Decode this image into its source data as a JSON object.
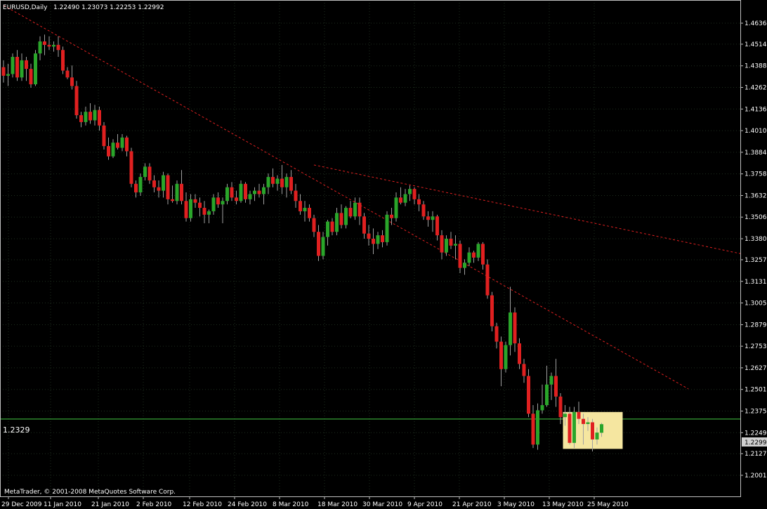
{
  "window": {
    "symbol_label": "EURUSD,Daily",
    "ohlc_label": "1.22490 1.23073 1.22253 1.22992",
    "copyright": "MetaTrader, © 2001-2008 MetaQuotes Software Corp."
  },
  "colors": {
    "background": "#000000",
    "grid": "#1e2e1e",
    "frame": "#c0c0c0",
    "bull": "#2aa52a",
    "bear": "#e02020",
    "wick": "#a0a0a0",
    "trendline": "#e02020",
    "hline": "#44cc44",
    "highlight": "#f5e6a0",
    "current_price_bg": "#d0d0d0"
  },
  "chart_data": {
    "type": "candlestick",
    "symbol": "EURUSD",
    "timeframe": "Daily",
    "ylim": [
      1.2001,
      1.4689
    ],
    "yticks": [
      "1.46365",
      "1.45140",
      "1.43880",
      "1.42620",
      "1.41360",
      "1.40100",
      "1.38840",
      "1.37580",
      "1.36320",
      "1.35060",
      "1.33800",
      "1.32575",
      "1.31315",
      "1.30055",
      "1.28790",
      "1.27535",
      "1.26275",
      "1.25015",
      "1.23755",
      "1.22495",
      "1.21270",
      "1.20010"
    ],
    "xticks": [
      "29 Dec 2009",
      "11 Jan 2010",
      "21 Jan 2010",
      "2 Feb 2010",
      "12 Feb 2010",
      "24 Feb 2010",
      "8 Mar 2010",
      "18 Mar 2010",
      "30 Mar 2010",
      "9 Apr 2010",
      "21 Apr 2010",
      "3 May 2010",
      "13 May 2010",
      "25 May 2010"
    ],
    "grid": true,
    "hline": {
      "value": 1.2329,
      "label": "1.2329"
    },
    "current_price": "1.22992",
    "candles": [
      {
        "o": 1.438,
        "h": 1.442,
        "l": 1.429,
        "c": 1.433
      },
      {
        "o": 1.433,
        "h": 1.44,
        "l": 1.427,
        "c": 1.434
      },
      {
        "o": 1.434,
        "h": 1.446,
        "l": 1.432,
        "c": 1.444
      },
      {
        "o": 1.444,
        "h": 1.448,
        "l": 1.43,
        "c": 1.432
      },
      {
        "o": 1.432,
        "h": 1.446,
        "l": 1.43,
        "c": 1.442
      },
      {
        "o": 1.442,
        "h": 1.444,
        "l": 1.43,
        "c": 1.437
      },
      {
        "o": 1.437,
        "h": 1.44,
        "l": 1.426,
        "c": 1.428
      },
      {
        "o": 1.428,
        "h": 1.448,
        "l": 1.427,
        "c": 1.446
      },
      {
        "o": 1.446,
        "h": 1.456,
        "l": 1.442,
        "c": 1.453
      },
      {
        "o": 1.453,
        "h": 1.457,
        "l": 1.445,
        "c": 1.451
      },
      {
        "o": 1.451,
        "h": 1.456,
        "l": 1.448,
        "c": 1.45
      },
      {
        "o": 1.45,
        "h": 1.453,
        "l": 1.447,
        "c": 1.451
      },
      {
        "o": 1.451,
        "h": 1.456,
        "l": 1.444,
        "c": 1.448
      },
      {
        "o": 1.448,
        "h": 1.45,
        "l": 1.434,
        "c": 1.436
      },
      {
        "o": 1.436,
        "h": 1.438,
        "l": 1.431,
        "c": 1.432
      },
      {
        "o": 1.432,
        "h": 1.439,
        "l": 1.425,
        "c": 1.427
      },
      {
        "o": 1.427,
        "h": 1.43,
        "l": 1.408,
        "c": 1.41
      },
      {
        "o": 1.41,
        "h": 1.412,
        "l": 1.403,
        "c": 1.406
      },
      {
        "o": 1.406,
        "h": 1.415,
        "l": 1.404,
        "c": 1.412
      },
      {
        "o": 1.412,
        "h": 1.417,
        "l": 1.405,
        "c": 1.407
      },
      {
        "o": 1.407,
        "h": 1.416,
        "l": 1.404,
        "c": 1.413
      },
      {
        "o": 1.413,
        "h": 1.415,
        "l": 1.401,
        "c": 1.404
      },
      {
        "o": 1.404,
        "h": 1.406,
        "l": 1.39,
        "c": 1.392
      },
      {
        "o": 1.392,
        "h": 1.397,
        "l": 1.384,
        "c": 1.386
      },
      {
        "o": 1.386,
        "h": 1.396,
        "l": 1.385,
        "c": 1.394
      },
      {
        "o": 1.394,
        "h": 1.399,
        "l": 1.39,
        "c": 1.391
      },
      {
        "o": 1.391,
        "h": 1.399,
        "l": 1.389,
        "c": 1.397
      },
      {
        "o": 1.397,
        "h": 1.398,
        "l": 1.386,
        "c": 1.389
      },
      {
        "o": 1.389,
        "h": 1.391,
        "l": 1.368,
        "c": 1.37
      },
      {
        "o": 1.37,
        "h": 1.372,
        "l": 1.362,
        "c": 1.365
      },
      {
        "o": 1.365,
        "h": 1.376,
        "l": 1.363,
        "c": 1.374
      },
      {
        "o": 1.374,
        "h": 1.382,
        "l": 1.372,
        "c": 1.38
      },
      {
        "o": 1.38,
        "h": 1.382,
        "l": 1.37,
        "c": 1.372
      },
      {
        "o": 1.372,
        "h": 1.375,
        "l": 1.365,
        "c": 1.368
      },
      {
        "o": 1.368,
        "h": 1.372,
        "l": 1.362,
        "c": 1.366
      },
      {
        "o": 1.366,
        "h": 1.377,
        "l": 1.362,
        "c": 1.375
      },
      {
        "o": 1.375,
        "h": 1.376,
        "l": 1.358,
        "c": 1.361
      },
      {
        "o": 1.361,
        "h": 1.369,
        "l": 1.359,
        "c": 1.36
      },
      {
        "o": 1.36,
        "h": 1.372,
        "l": 1.358,
        "c": 1.37
      },
      {
        "o": 1.37,
        "h": 1.378,
        "l": 1.358,
        "c": 1.36
      },
      {
        "o": 1.36,
        "h": 1.365,
        "l": 1.348,
        "c": 1.35
      },
      {
        "o": 1.35,
        "h": 1.364,
        "l": 1.348,
        "c": 1.361
      },
      {
        "o": 1.361,
        "h": 1.364,
        "l": 1.356,
        "c": 1.359
      },
      {
        "o": 1.359,
        "h": 1.362,
        "l": 1.351,
        "c": 1.356
      },
      {
        "o": 1.356,
        "h": 1.36,
        "l": 1.347,
        "c": 1.352
      },
      {
        "o": 1.352,
        "h": 1.355,
        "l": 1.347,
        "c": 1.354
      },
      {
        "o": 1.354,
        "h": 1.364,
        "l": 1.352,
        "c": 1.362
      },
      {
        "o": 1.362,
        "h": 1.365,
        "l": 1.356,
        "c": 1.358
      },
      {
        "o": 1.358,
        "h": 1.362,
        "l": 1.347,
        "c": 1.36
      },
      {
        "o": 1.36,
        "h": 1.37,
        "l": 1.358,
        "c": 1.368
      },
      {
        "o": 1.368,
        "h": 1.371,
        "l": 1.36,
        "c": 1.362
      },
      {
        "o": 1.362,
        "h": 1.366,
        "l": 1.358,
        "c": 1.36
      },
      {
        "o": 1.36,
        "h": 1.372,
        "l": 1.359,
        "c": 1.37
      },
      {
        "o": 1.37,
        "h": 1.371,
        "l": 1.359,
        "c": 1.361
      },
      {
        "o": 1.361,
        "h": 1.366,
        "l": 1.358,
        "c": 1.364
      },
      {
        "o": 1.364,
        "h": 1.368,
        "l": 1.36,
        "c": 1.366
      },
      {
        "o": 1.366,
        "h": 1.37,
        "l": 1.362,
        "c": 1.364
      },
      {
        "o": 1.364,
        "h": 1.37,
        "l": 1.358,
        "c": 1.368
      },
      {
        "o": 1.368,
        "h": 1.376,
        "l": 1.364,
        "c": 1.374
      },
      {
        "o": 1.374,
        "h": 1.379,
        "l": 1.368,
        "c": 1.37
      },
      {
        "o": 1.37,
        "h": 1.375,
        "l": 1.366,
        "c": 1.373
      },
      {
        "o": 1.373,
        "h": 1.381,
        "l": 1.364,
        "c": 1.368
      },
      {
        "o": 1.368,
        "h": 1.376,
        "l": 1.362,
        "c": 1.374
      },
      {
        "o": 1.374,
        "h": 1.378,
        "l": 1.364,
        "c": 1.366
      },
      {
        "o": 1.366,
        "h": 1.37,
        "l": 1.356,
        "c": 1.36
      },
      {
        "o": 1.36,
        "h": 1.364,
        "l": 1.352,
        "c": 1.354
      },
      {
        "o": 1.354,
        "h": 1.36,
        "l": 1.348,
        "c": 1.356
      },
      {
        "o": 1.356,
        "h": 1.358,
        "l": 1.348,
        "c": 1.35
      },
      {
        "o": 1.35,
        "h": 1.352,
        "l": 1.339,
        "c": 1.342
      },
      {
        "o": 1.342,
        "h": 1.346,
        "l": 1.325,
        "c": 1.328
      },
      {
        "o": 1.328,
        "h": 1.342,
        "l": 1.326,
        "c": 1.339
      },
      {
        "o": 1.339,
        "h": 1.349,
        "l": 1.334,
        "c": 1.348
      },
      {
        "o": 1.348,
        "h": 1.35,
        "l": 1.34,
        "c": 1.342
      },
      {
        "o": 1.342,
        "h": 1.356,
        "l": 1.34,
        "c": 1.353
      },
      {
        "o": 1.353,
        "h": 1.358,
        "l": 1.344,
        "c": 1.346
      },
      {
        "o": 1.346,
        "h": 1.357,
        "l": 1.344,
        "c": 1.356
      },
      {
        "o": 1.356,
        "h": 1.36,
        "l": 1.35,
        "c": 1.351
      },
      {
        "o": 1.351,
        "h": 1.362,
        "l": 1.349,
        "c": 1.359
      },
      {
        "o": 1.359,
        "h": 1.362,
        "l": 1.346,
        "c": 1.351
      },
      {
        "o": 1.351,
        "h": 1.353,
        "l": 1.338,
        "c": 1.341
      },
      {
        "o": 1.341,
        "h": 1.346,
        "l": 1.334,
        "c": 1.338
      },
      {
        "o": 1.338,
        "h": 1.344,
        "l": 1.329,
        "c": 1.335
      },
      {
        "o": 1.335,
        "h": 1.342,
        "l": 1.332,
        "c": 1.34
      },
      {
        "o": 1.34,
        "h": 1.343,
        "l": 1.333,
        "c": 1.336
      },
      {
        "o": 1.336,
        "h": 1.354,
        "l": 1.334,
        "c": 1.352
      },
      {
        "o": 1.352,
        "h": 1.356,
        "l": 1.346,
        "c": 1.35
      },
      {
        "o": 1.35,
        "h": 1.365,
        "l": 1.348,
        "c": 1.362
      },
      {
        "o": 1.362,
        "h": 1.368,
        "l": 1.358,
        "c": 1.359
      },
      {
        "o": 1.359,
        "h": 1.367,
        "l": 1.357,
        "c": 1.364
      },
      {
        "o": 1.364,
        "h": 1.369,
        "l": 1.36,
        "c": 1.367
      },
      {
        "o": 1.367,
        "h": 1.368,
        "l": 1.358,
        "c": 1.361
      },
      {
        "o": 1.361,
        "h": 1.364,
        "l": 1.354,
        "c": 1.358
      },
      {
        "o": 1.358,
        "h": 1.36,
        "l": 1.349,
        "c": 1.351
      },
      {
        "o": 1.351,
        "h": 1.354,
        "l": 1.345,
        "c": 1.349
      },
      {
        "o": 1.349,
        "h": 1.354,
        "l": 1.342,
        "c": 1.351
      },
      {
        "o": 1.351,
        "h": 1.352,
        "l": 1.337,
        "c": 1.34
      },
      {
        "o": 1.34,
        "h": 1.343,
        "l": 1.326,
        "c": 1.33
      },
      {
        "o": 1.33,
        "h": 1.34,
        "l": 1.328,
        "c": 1.338
      },
      {
        "o": 1.338,
        "h": 1.342,
        "l": 1.332,
        "c": 1.334
      },
      {
        "o": 1.334,
        "h": 1.34,
        "l": 1.326,
        "c": 1.335
      },
      {
        "o": 1.335,
        "h": 1.337,
        "l": 1.318,
        "c": 1.321
      },
      {
        "o": 1.321,
        "h": 1.326,
        "l": 1.317,
        "c": 1.324
      },
      {
        "o": 1.324,
        "h": 1.333,
        "l": 1.322,
        "c": 1.33
      },
      {
        "o": 1.33,
        "h": 1.331,
        "l": 1.324,
        "c": 1.327
      },
      {
        "o": 1.327,
        "h": 1.336,
        "l": 1.325,
        "c": 1.335
      },
      {
        "o": 1.335,
        "h": 1.336,
        "l": 1.32,
        "c": 1.323
      },
      {
        "o": 1.323,
        "h": 1.326,
        "l": 1.303,
        "c": 1.305
      },
      {
        "o": 1.305,
        "h": 1.307,
        "l": 1.284,
        "c": 1.287
      },
      {
        "o": 1.287,
        "h": 1.289,
        "l": 1.274,
        "c": 1.278
      },
      {
        "o": 1.278,
        "h": 1.281,
        "l": 1.252,
        "c": 1.262
      },
      {
        "o": 1.262,
        "h": 1.278,
        "l": 1.26,
        "c": 1.276
      },
      {
        "o": 1.276,
        "h": 1.31,
        "l": 1.27,
        "c": 1.295
      },
      {
        "o": 1.295,
        "h": 1.298,
        "l": 1.272,
        "c": 1.277
      },
      {
        "o": 1.277,
        "h": 1.28,
        "l": 1.262,
        "c": 1.265
      },
      {
        "o": 1.265,
        "h": 1.268,
        "l": 1.254,
        "c": 1.258
      },
      {
        "o": 1.258,
        "h": 1.262,
        "l": 1.234,
        "c": 1.236
      },
      {
        "o": 1.236,
        "h": 1.241,
        "l": 1.216,
        "c": 1.218
      },
      {
        "o": 1.218,
        "h": 1.242,
        "l": 1.215,
        "c": 1.238
      },
      {
        "o": 1.238,
        "h": 1.253,
        "l": 1.236,
        "c": 1.241
      },
      {
        "o": 1.241,
        "h": 1.264,
        "l": 1.24,
        "c": 1.253
      },
      {
        "o": 1.253,
        "h": 1.26,
        "l": 1.244,
        "c": 1.258
      },
      {
        "o": 1.258,
        "h": 1.268,
        "l": 1.24,
        "c": 1.246
      },
      {
        "o": 1.246,
        "h": 1.248,
        "l": 1.23,
        "c": 1.234
      },
      {
        "o": 1.234,
        "h": 1.241,
        "l": 1.229,
        "c": 1.236
      },
      {
        "o": 1.236,
        "h": 1.24,
        "l": 1.218,
        "c": 1.219
      },
      {
        "o": 1.219,
        "h": 1.24,
        "l": 1.216,
        "c": 1.237
      },
      {
        "o": 1.237,
        "h": 1.243,
        "l": 1.23,
        "c": 1.233
      },
      {
        "o": 1.233,
        "h": 1.236,
        "l": 1.218,
        "c": 1.23
      },
      {
        "o": 1.23,
        "h": 1.234,
        "l": 1.226,
        "c": 1.231
      },
      {
        "o": 1.231,
        "h": 1.233,
        "l": 1.214,
        "c": 1.221
      },
      {
        "o": 1.221,
        "h": 1.228,
        "l": 1.218,
        "c": 1.225
      },
      {
        "o": 1.2249,
        "h": 1.2307,
        "l": 1.2225,
        "c": 1.2299
      }
    ]
  }
}
